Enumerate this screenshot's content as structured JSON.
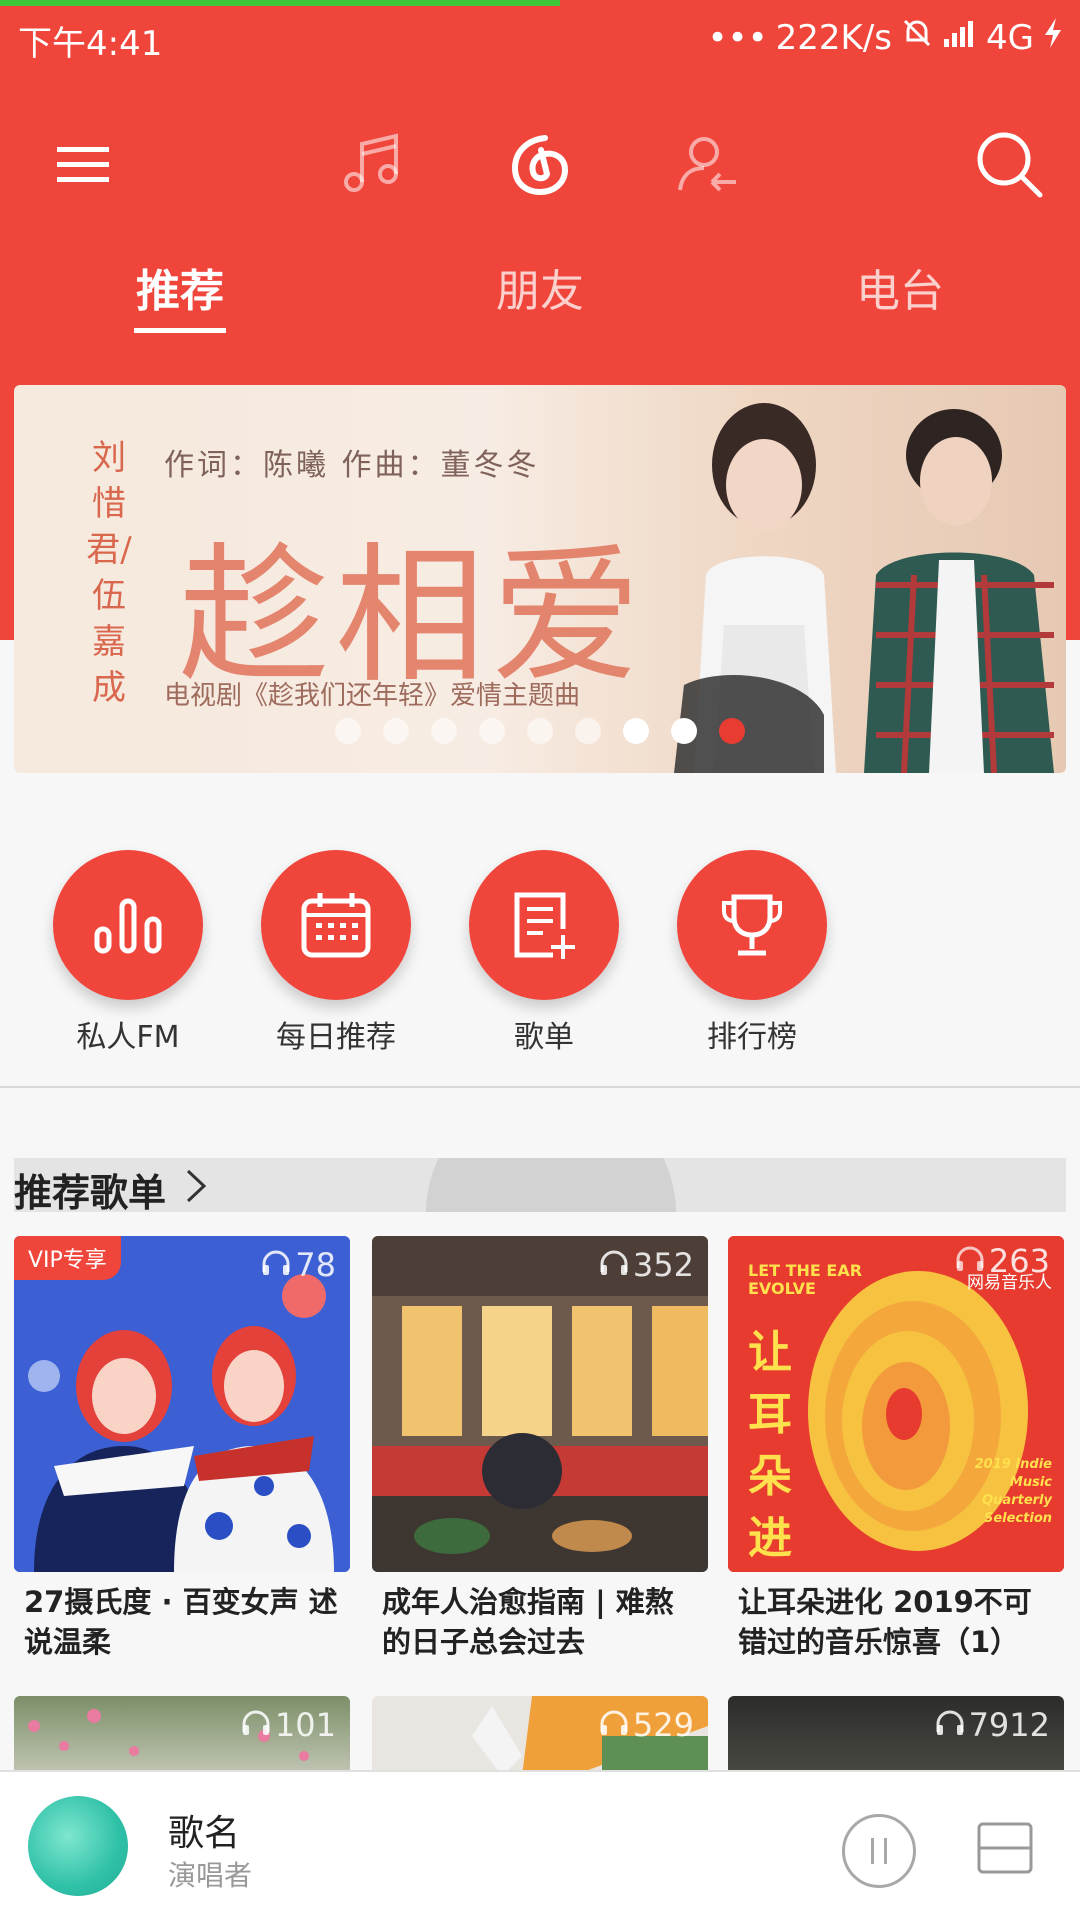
{
  "status_bar": {
    "time": "下午4:41",
    "net_speed": "222K/s",
    "network": "4G"
  },
  "toolbar": {
    "icons": [
      "menu-icon",
      "music-icon",
      "netease-logo-icon",
      "user-switch-icon",
      "search-icon"
    ]
  },
  "tabs": [
    {
      "label": "推荐",
      "active": true
    },
    {
      "label": "朋友",
      "active": false
    },
    {
      "label": "电台",
      "active": false
    }
  ],
  "banner": {
    "side_name": "刘惜君/伍嘉成",
    "credits": "作词：陈曦   作曲：董冬冬",
    "title": "趁相爱",
    "subtitle": "电视剧《趁我们还年轻》爱情主题曲",
    "dots_total": 9,
    "dots_current": 9
  },
  "quick_actions": [
    {
      "label": "私人FM",
      "icon": "radio-bars-icon"
    },
    {
      "label": "每日推荐",
      "icon": "calendar-icon"
    },
    {
      "label": "歌单",
      "icon": "playlist-add-icon"
    },
    {
      "label": "排行榜",
      "icon": "trophy-icon"
    }
  ],
  "section": {
    "title": "推荐歌单"
  },
  "playlists": [
    {
      "count": "78",
      "name": "27摄氏度 · 百变女声 述说温柔",
      "badge": "VIP专享",
      "cover_tag": ""
    },
    {
      "count": "352",
      "name": "成年人治愈指南 | 难熬的日子总会过去",
      "badge": "",
      "cover_tag": ""
    },
    {
      "count": "263",
      "name": "让耳朵进化  2019不可错过的音乐惊喜（1）",
      "badge": "",
      "cover_tag": "网易音乐人",
      "cover_text": {
        "top": "LET THE EAR EVOLVE",
        "big": "让耳朵进化",
        "side": "2019 Indie Music Quarterly Selection"
      }
    },
    {
      "count": "101",
      "name": "",
      "badge": "",
      "cover_tag": ""
    },
    {
      "count": "529",
      "name": "",
      "badge": "",
      "cover_tag": ""
    },
    {
      "count": "7912",
      "name": "",
      "badge": "",
      "cover_tag": ""
    }
  ],
  "player": {
    "song": "歌名",
    "artist": "演唱者"
  },
  "colors": {
    "brand_red": "#f0453b",
    "progress_green": "#3ec63a"
  }
}
